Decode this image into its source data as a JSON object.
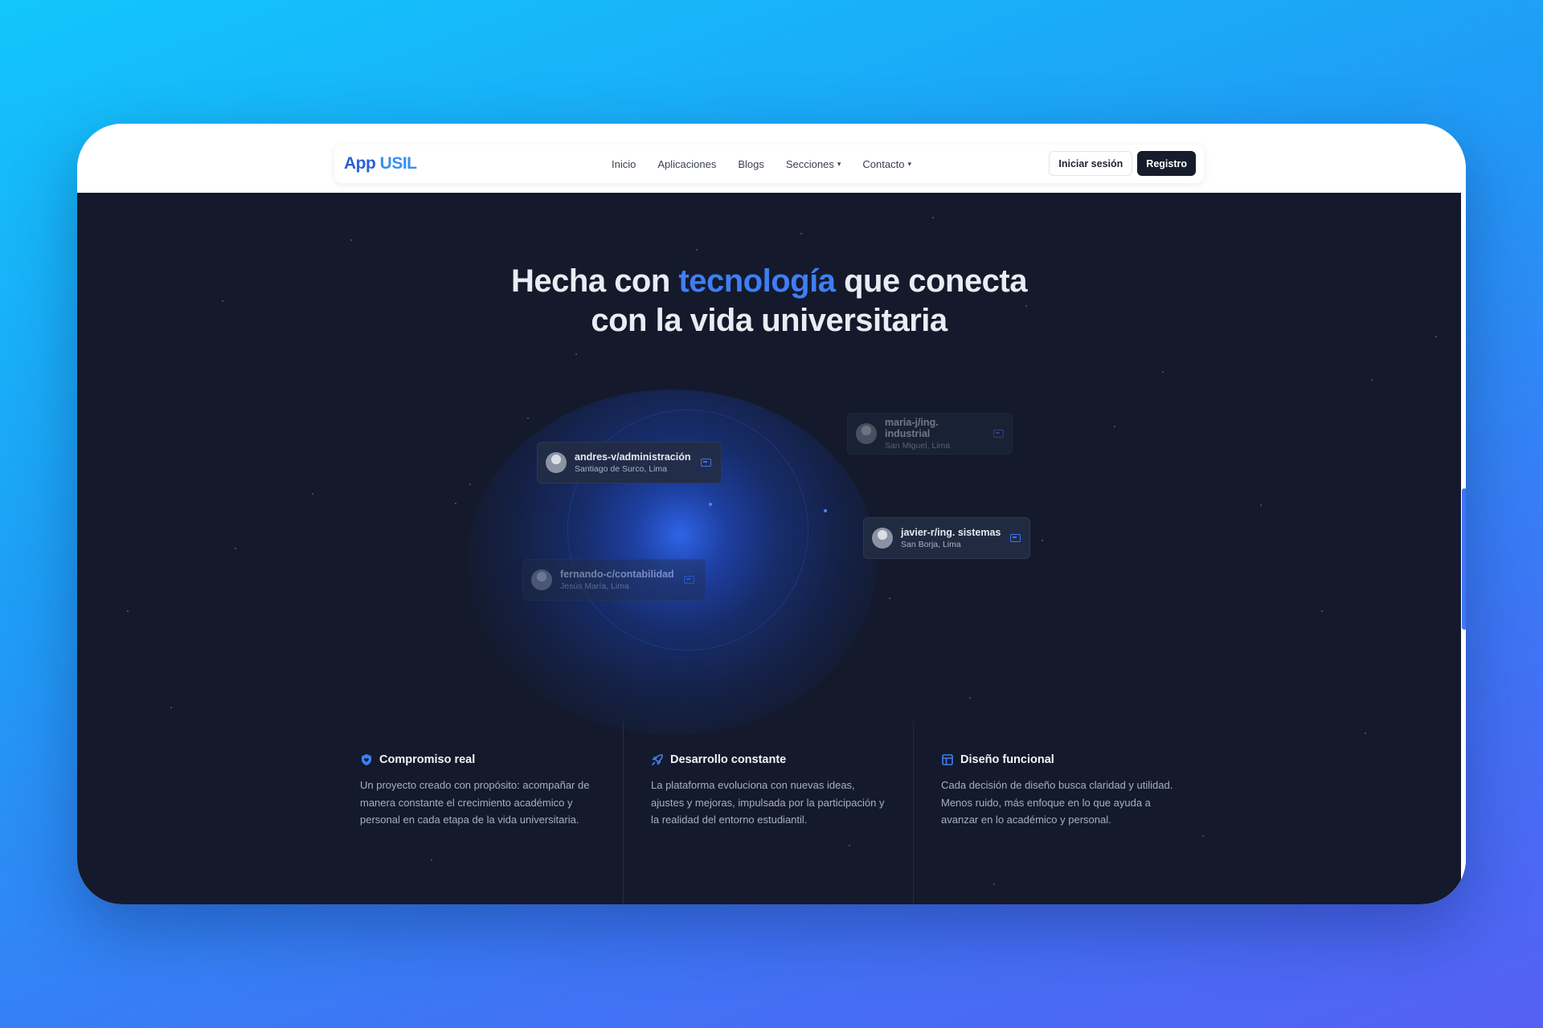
{
  "header": {
    "logo_app": "App",
    "logo_brand": "USIL",
    "nav": [
      "Inicio",
      "Aplicaciones",
      "Blogs",
      "Secciones",
      "Contacto"
    ],
    "login_label": "Iniciar sesión",
    "register_label": "Registro"
  },
  "hero": {
    "title_pre": "Hecha con ",
    "title_accent": "tecnología",
    "title_post": " que conecta",
    "title_line2": "con la vida universitaria"
  },
  "profiles": [
    {
      "name": "andres-v/administración",
      "location": "Santiago de Surco, Lima"
    },
    {
      "name": "maria-j/ing. industrial",
      "location": "San Miguel, Lima"
    },
    {
      "name": "javier-r/ing. sistemas",
      "location": "San Borja, Lima"
    },
    {
      "name": "fernando-c/contabilidad",
      "location": "Jesús María, Lima"
    }
  ],
  "features": [
    {
      "icon": "shield-heart-icon",
      "title": "Compromiso real",
      "desc": "Un proyecto creado con propósito: acompañar de manera constante el crecimiento académico y personal en cada etapa de la vida universitaria."
    },
    {
      "icon": "rocket-icon",
      "title": "Desarrollo constante",
      "desc": "La plataforma evoluciona con nuevas ideas, ajustes y mejoras, impulsada por la participación y la realidad del entorno estudiantil."
    },
    {
      "icon": "layout-icon",
      "title": "Diseño funcional",
      "desc": "Cada decisión de diseño busca claridad y utilidad. Menos ruido, más enfoque en lo que ayuda a avanzar en lo académico y personal."
    }
  ],
  "colors": {
    "accent": "#3f7ef5",
    "dark_bg": "#141a2b",
    "button_dark": "#161c2b"
  }
}
